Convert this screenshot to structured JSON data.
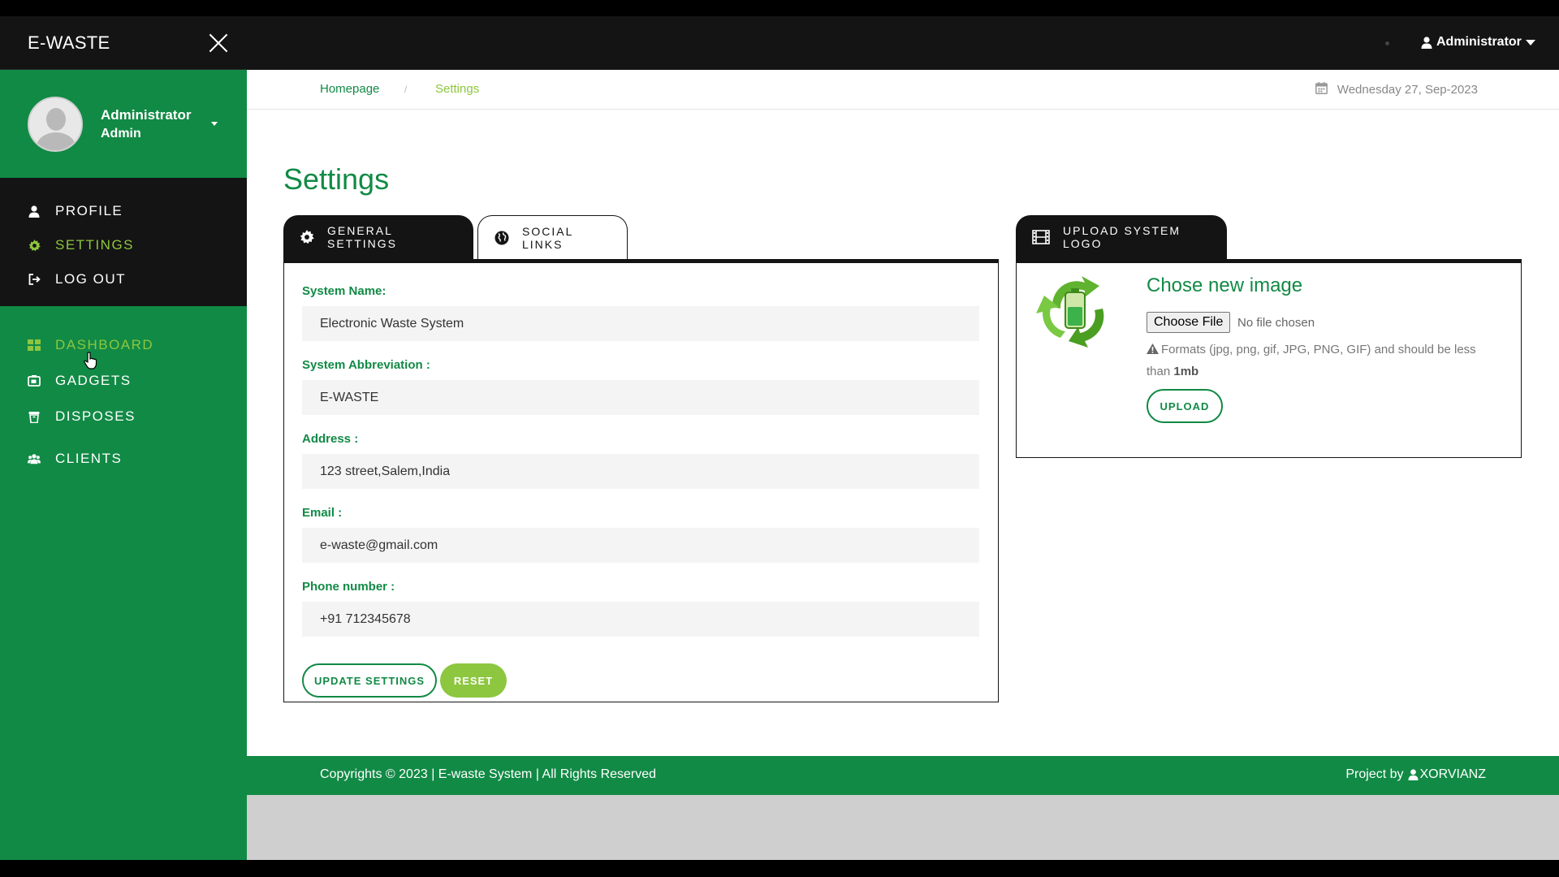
{
  "brand": {
    "name": "E-WASTE"
  },
  "user_panel": {
    "name": "Administrator",
    "role": "Admin"
  },
  "sidebar": {
    "top_items": [
      {
        "label": "PROFILE",
        "icon": "user-icon",
        "active": false
      },
      {
        "label": "SETTINGS",
        "icon": "gear-icon",
        "active": true
      },
      {
        "label": "LOG OUT",
        "icon": "sign-out-icon",
        "active": false
      }
    ],
    "bottom_items": [
      {
        "label": "DASHBOARD",
        "icon": "grid-icon",
        "active": true
      },
      {
        "label": "GADGETS",
        "icon": "device-icon",
        "active": false
      },
      {
        "label": "DISPOSES",
        "icon": "trash-icon",
        "active": false
      },
      {
        "label": "CLIENTS",
        "icon": "users-icon",
        "active": false
      }
    ]
  },
  "topbar": {
    "user": "Administrator"
  },
  "breadcrumb": {
    "home": "Homepage",
    "separator": "/",
    "current": "Settings"
  },
  "date": "Wednesday 27, Sep-2023",
  "page": {
    "title": "Settings"
  },
  "tabs": {
    "general": "GENERAL SETTINGS",
    "social": "SOCIAL LINKS",
    "upload": "UPLOAD SYSTEM LOGO"
  },
  "form": {
    "system_name": {
      "label": "System Name:",
      "value": "Electronic Waste System"
    },
    "abbreviation": {
      "label": "System Abbreviation :",
      "value": "E-WASTE"
    },
    "address": {
      "label": "Address :",
      "value": "123 street,Salem,India"
    },
    "email": {
      "label": "Email :",
      "value": "e-waste@gmail.com"
    },
    "phone": {
      "label": "Phone number :",
      "value": "+91 712345678"
    },
    "update_button": "UPDATE SETTINGS",
    "reset_button": "RESET"
  },
  "upload": {
    "title": "Chose new image",
    "choose_button": "Choose File",
    "file_status": "No file chosen",
    "note_prefix": "Formats (jpg, png, gif, JPG, PNG, GIF) and should be less than",
    "note_size": "1mb",
    "upload_button": "UPLOAD"
  },
  "footer": {
    "copyright": "Copyrights © 2023 | E-waste System | All Rights Reserved",
    "project_prefix": "Project by",
    "project_author": "XORVIANZ"
  },
  "colors": {
    "brand_green": "#118a45",
    "accent_lime": "#8dc63f",
    "dark": "#141414"
  }
}
